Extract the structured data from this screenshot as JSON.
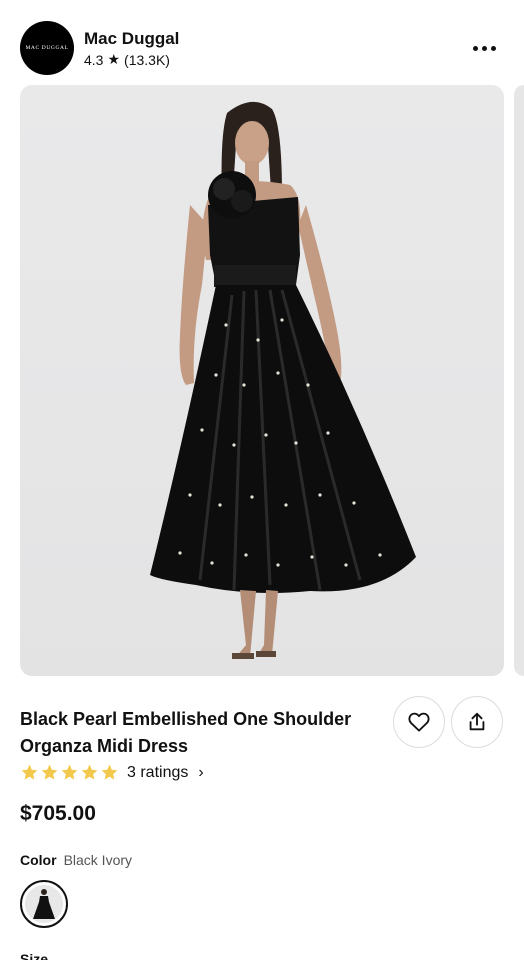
{
  "shop": {
    "logo_text": "MAC DUGGAL",
    "name": "Mac Duggal",
    "rating": "4.3",
    "rating_star": "★",
    "review_count": "(13.3K)"
  },
  "header": {
    "more_icon": "more-horizontal-icon"
  },
  "product": {
    "title": "Black Pearl Embellished One Shoulder Organza Midi Dress",
    "ratings_label": "3 ratings",
    "ratings_chevron": "›",
    "star_count": 5,
    "star_color": "#F2C94C",
    "price": "$705.00",
    "color_label": "Color",
    "color_value": "Black Ivory",
    "size_label": "Size"
  },
  "actions": {
    "favorite_icon": "heart-icon",
    "share_icon": "share-icon"
  },
  "colors": {
    "text": "#111111",
    "muted": "#555555",
    "image_bg": "#E7E7E8"
  }
}
